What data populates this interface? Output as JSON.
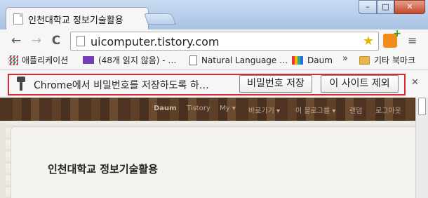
{
  "tab": {
    "title": "인천대학교 정보기술활용"
  },
  "window_controls": {
    "minimize": "–",
    "maximize": "□",
    "close": "✕"
  },
  "toolbar": {
    "back": "←",
    "forward": "→",
    "reload": "C",
    "url": "uicomputer.tistory.com",
    "star": "★",
    "menu": "≡"
  },
  "bookmarks": {
    "items": [
      {
        "label": "애플리케이션",
        "icon": "apps-grid-icon"
      },
      {
        "label": "(48개 읽지 않음) - …",
        "icon": "mail-icon"
      },
      {
        "label": "Natural Language …",
        "icon": "page-icon"
      },
      {
        "label": "Daum",
        "icon": "daum-icon"
      }
    ],
    "overflow": "»",
    "other_folder": "기타 북마크"
  },
  "infobar": {
    "message": "Chrome에서 비밀번호를 저장하도록 하…",
    "save_button": "비밀번호 저장",
    "never_button": "이 사이트 제외",
    "close": "✕"
  },
  "blog_nav": {
    "items": [
      "Daum",
      "Tistory",
      "My ▾",
      "바로가기 ▾",
      "이 블로그를 ▾",
      "랜덤",
      "로그아웃"
    ]
  },
  "blog": {
    "title": "인천대학교 정보기술활용"
  }
}
